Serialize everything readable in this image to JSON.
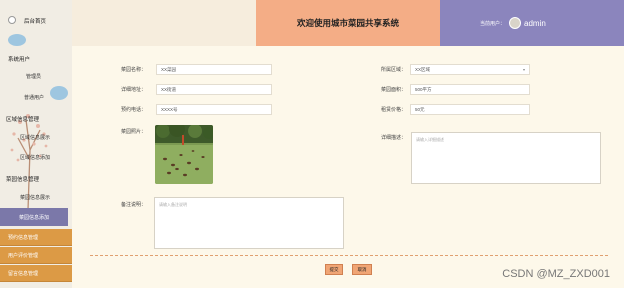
{
  "sidebar": {
    "brand": "后台首页",
    "items": [
      {
        "label": "系统用户",
        "group": true
      },
      {
        "label": "管理员",
        "group": false
      },
      {
        "label": "普通用户",
        "group": false
      },
      {
        "label": "区域信息管理",
        "group": true
      },
      {
        "label": "区域信息展示",
        "group": false
      },
      {
        "label": "区域信息添加",
        "group": false
      },
      {
        "label": "菜园信息管理",
        "group": true
      },
      {
        "label": "菜园信息展示",
        "group": false
      }
    ],
    "active": "菜园信息添加",
    "bottom_items": [
      "预约信息管理",
      "用户评价管理",
      "留言信息管理"
    ]
  },
  "header": {
    "title": "欢迎使用城市菜园共享系统",
    "user_label": "当前用户：",
    "username": "admin"
  },
  "form": {
    "name_label": "菜园名称：",
    "name_value": "XX菜园",
    "area_label": "所属区域：",
    "area_value": "XX区域",
    "address_label": "详细地址：",
    "address_value": "XX街道",
    "size_label": "菜园面积：",
    "size_value": "500平方",
    "phone_label": "预约电话：",
    "phone_value": "XXXX号",
    "price_label": "租赁价格：",
    "price_value": "50元",
    "photo_label": "菜园照片：",
    "detail_label": "详细描述：",
    "detail_placeholder": "请输入详细描述",
    "note_label": "备注说明：",
    "note_placeholder": "请输入备注说明",
    "submit_label": "提交",
    "reset_label": "取消"
  },
  "watermark": "CSDN @MZ_ZXD001",
  "colors": {
    "header_center": "#f4ad86",
    "header_right": "#8b85bd",
    "active_item": "#7b78a9",
    "orange_item": "#dc9a45"
  }
}
